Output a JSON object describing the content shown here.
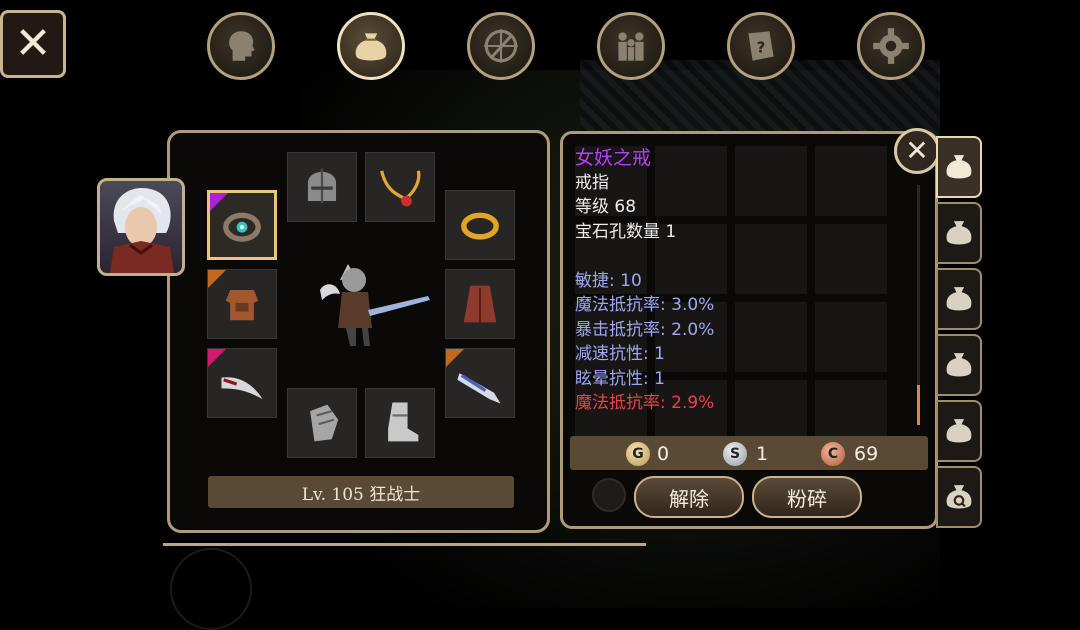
{
  "top_tabs": [
    {
      "id": "character",
      "icon": "head-silhouette-icon",
      "active": false
    },
    {
      "id": "inventory",
      "icon": "bag-icon",
      "active": true
    },
    {
      "id": "skills",
      "icon": "sword-compass-icon",
      "active": false
    },
    {
      "id": "party",
      "icon": "party-icon",
      "active": false
    },
    {
      "id": "quests",
      "icon": "scroll-icon",
      "active": false
    },
    {
      "id": "settings",
      "icon": "gear-icon",
      "active": false
    }
  ],
  "equipment": {
    "level_label": "Lv. 105 狂战士",
    "slots": [
      {
        "id": "ring",
        "icon": "ring-icon",
        "rarity": "purple",
        "selected": true
      },
      {
        "id": "helmet",
        "icon": "helmet-icon",
        "rarity": null,
        "selected": false
      },
      {
        "id": "necklace",
        "icon": "necklace-icon",
        "rarity": null,
        "selected": false
      },
      {
        "id": "ring2",
        "icon": "gold-ring-icon",
        "rarity": null,
        "selected": false
      },
      {
        "id": "armor",
        "icon": "armor-icon",
        "rarity": "orange",
        "selected": false
      },
      {
        "id": "cloak",
        "icon": "cloak-icon",
        "rarity": null,
        "selected": false
      },
      {
        "id": "offhand",
        "icon": "claw-blade-icon",
        "rarity": "pink",
        "selected": false
      },
      {
        "id": "weapon",
        "icon": "greatsword-icon",
        "rarity": "orange",
        "selected": false
      },
      {
        "id": "gloves",
        "icon": "gauntlet-icon",
        "rarity": null,
        "selected": false
      },
      {
        "id": "boots",
        "icon": "boots-icon",
        "rarity": null,
        "selected": false
      }
    ]
  },
  "item_detail": {
    "name": "女妖之戒",
    "type": "戒指",
    "level": "等级 68",
    "sockets": "宝石孔数量 1",
    "stats": [
      {
        "text": "敏捷: 10",
        "color": "blue"
      },
      {
        "text": "魔法抵抗率: 3.0%",
        "color": "blue"
      },
      {
        "text": "暴击抵抗率: 2.0%",
        "color": "blue"
      },
      {
        "text": "减速抗性: 1",
        "color": "blue"
      },
      {
        "text": "眩晕抗性: 1",
        "color": "blue"
      },
      {
        "text": "魔法抵抗率: 2.9%",
        "color": "red"
      }
    ],
    "currency": {
      "gold": {
        "symbol": "G",
        "value": "0"
      },
      "silver": {
        "symbol": "S",
        "value": "1"
      },
      "copper": {
        "symbol": "C",
        "value": "69"
      }
    },
    "buttons": {
      "unequip": "解除",
      "smash": "粉碎"
    }
  },
  "side_tabs": [
    {
      "icon": "bag-icon",
      "active": true
    },
    {
      "icon": "bag-icon",
      "active": false
    },
    {
      "icon": "bag-icon",
      "active": false
    },
    {
      "icon": "bag-icon",
      "active": false
    },
    {
      "icon": "bag-icon",
      "active": false
    },
    {
      "icon": "bag-search-icon",
      "active": false
    }
  ],
  "colors": {
    "accent_gold": "#e8c77a",
    "panel_border": "#b09b78",
    "item_name_purple": "#b441f5",
    "stat_blue": "#9fa7f3",
    "stat_red": "#ef3f4a"
  }
}
